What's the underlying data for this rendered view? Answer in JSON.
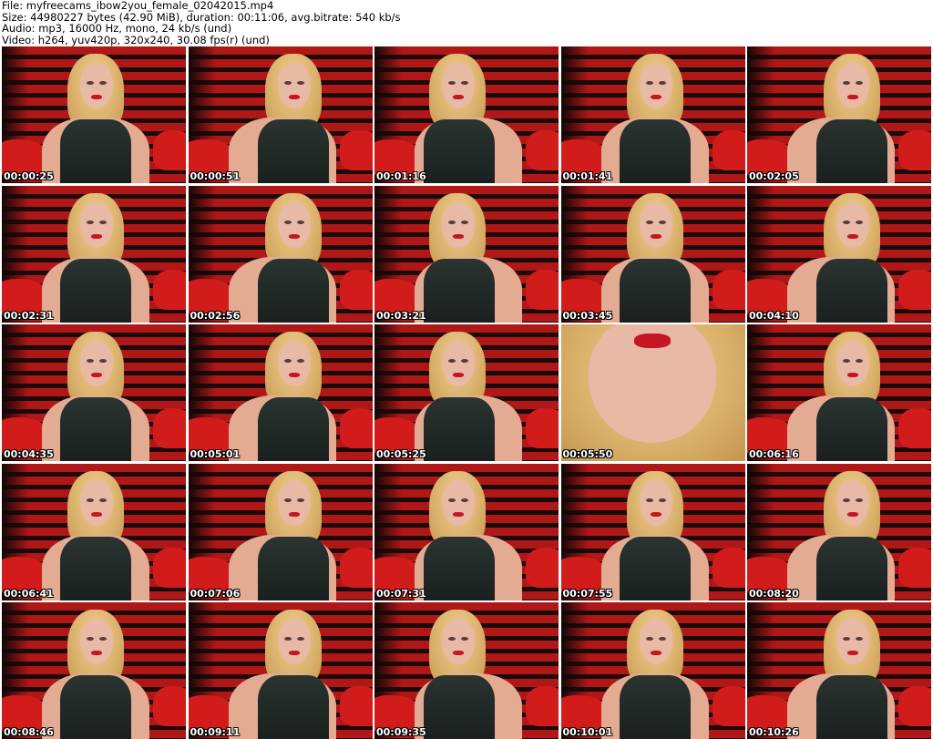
{
  "header": {
    "file": "File: myfreecams_ibow2you_female_02042015.mp4",
    "size": "Size: 44980227 bytes (42.90 MiB), duration: 00:11:06, avg.bitrate: 540 kb/s",
    "audio": "Audio: mp3, 16000 Hz, mono, 24 kb/s (und)",
    "video": "Video: h264, yuv420p, 320x240, 30.08 fps(r) (und)"
  },
  "thumbnails": [
    {
      "time": "00:00:25"
    },
    {
      "time": "00:00:51"
    },
    {
      "time": "00:01:16"
    },
    {
      "time": "00:01:41"
    },
    {
      "time": "00:02:05"
    },
    {
      "time": "00:02:31"
    },
    {
      "time": "00:02:56"
    },
    {
      "time": "00:03:21"
    },
    {
      "time": "00:03:45"
    },
    {
      "time": "00:04:10"
    },
    {
      "time": "00:04:35"
    },
    {
      "time": "00:05:01"
    },
    {
      "time": "00:05:25"
    },
    {
      "time": "00:05:50"
    },
    {
      "time": "00:06:16"
    },
    {
      "time": "00:06:41"
    },
    {
      "time": "00:07:06"
    },
    {
      "time": "00:07:31"
    },
    {
      "time": "00:07:55"
    },
    {
      "time": "00:08:20"
    },
    {
      "time": "00:08:46"
    },
    {
      "time": "00:09:11"
    },
    {
      "time": "00:09:35"
    },
    {
      "time": "00:10:01"
    },
    {
      "time": "00:10:26"
    }
  ]
}
